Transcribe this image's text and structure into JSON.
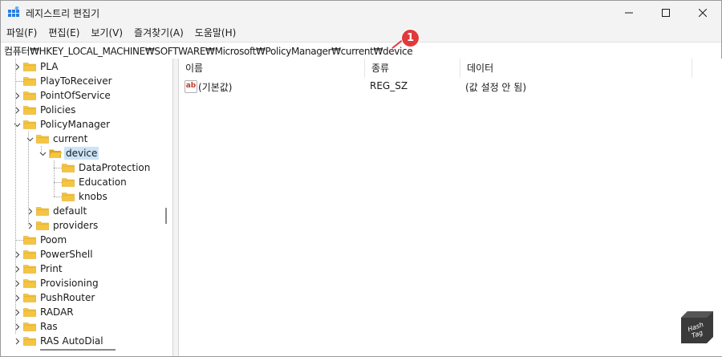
{
  "window": {
    "title": "레지스트리 편집기",
    "controls": {
      "minimize": "minimize",
      "maximize": "maximize",
      "close": "close"
    }
  },
  "menu": [
    "파일(F)",
    "편집(E)",
    "보기(V)",
    "즐겨찾기(A)",
    "도움말(H)"
  ],
  "address": "컴퓨터₩HKEY_LOCAL_MACHINE₩SOFTWARE₩Microsoft₩PolicyManager₩current₩device",
  "callout": {
    "number": "1",
    "color": "#e03a3a"
  },
  "tree": {
    "items": [
      {
        "label": "PLA",
        "level": 0,
        "expander": "collapsed"
      },
      {
        "label": "PlayToReceiver",
        "level": 0,
        "expander": "none"
      },
      {
        "label": "PointOfService",
        "level": 0,
        "expander": "collapsed"
      },
      {
        "label": "Policies",
        "level": 0,
        "expander": "collapsed"
      },
      {
        "label": "PolicyManager",
        "level": 0,
        "expander": "expanded"
      },
      {
        "label": "current",
        "level": 1,
        "expander": "expanded"
      },
      {
        "label": "device",
        "level": 2,
        "expander": "expanded",
        "selected": true,
        "open": true
      },
      {
        "label": "DataProtection",
        "level": 3,
        "expander": "none"
      },
      {
        "label": "Education",
        "level": 3,
        "expander": "none"
      },
      {
        "label": "knobs",
        "level": 3,
        "expander": "none"
      },
      {
        "label": "default",
        "level": 1,
        "expander": "collapsed"
      },
      {
        "label": "providers",
        "level": 1,
        "expander": "collapsed"
      },
      {
        "label": "Poom",
        "level": 0,
        "expander": "none"
      },
      {
        "label": "PowerShell",
        "level": 0,
        "expander": "collapsed"
      },
      {
        "label": "Print",
        "level": 0,
        "expander": "collapsed"
      },
      {
        "label": "Provisioning",
        "level": 0,
        "expander": "collapsed"
      },
      {
        "label": "PushRouter",
        "level": 0,
        "expander": "collapsed"
      },
      {
        "label": "RADAR",
        "level": 0,
        "expander": "collapsed"
      },
      {
        "label": "Ras",
        "level": 0,
        "expander": "collapsed"
      },
      {
        "label": "RAS AutoDial",
        "level": 0,
        "expander": "collapsed"
      }
    ]
  },
  "list": {
    "columns": [
      "이름",
      "종류",
      "데이터"
    ],
    "rows": [
      {
        "name": "(기본값)",
        "type": "REG_SZ",
        "data": "(값 설정 안 됨)",
        "icon": "ab-string-icon"
      }
    ]
  },
  "icons": {
    "folder": "#f5c542",
    "folder_edge": "#d9a521",
    "app_icon": "registry-editor-icon"
  },
  "watermark": {
    "line1": "Hash",
    "line2": "Tag"
  }
}
